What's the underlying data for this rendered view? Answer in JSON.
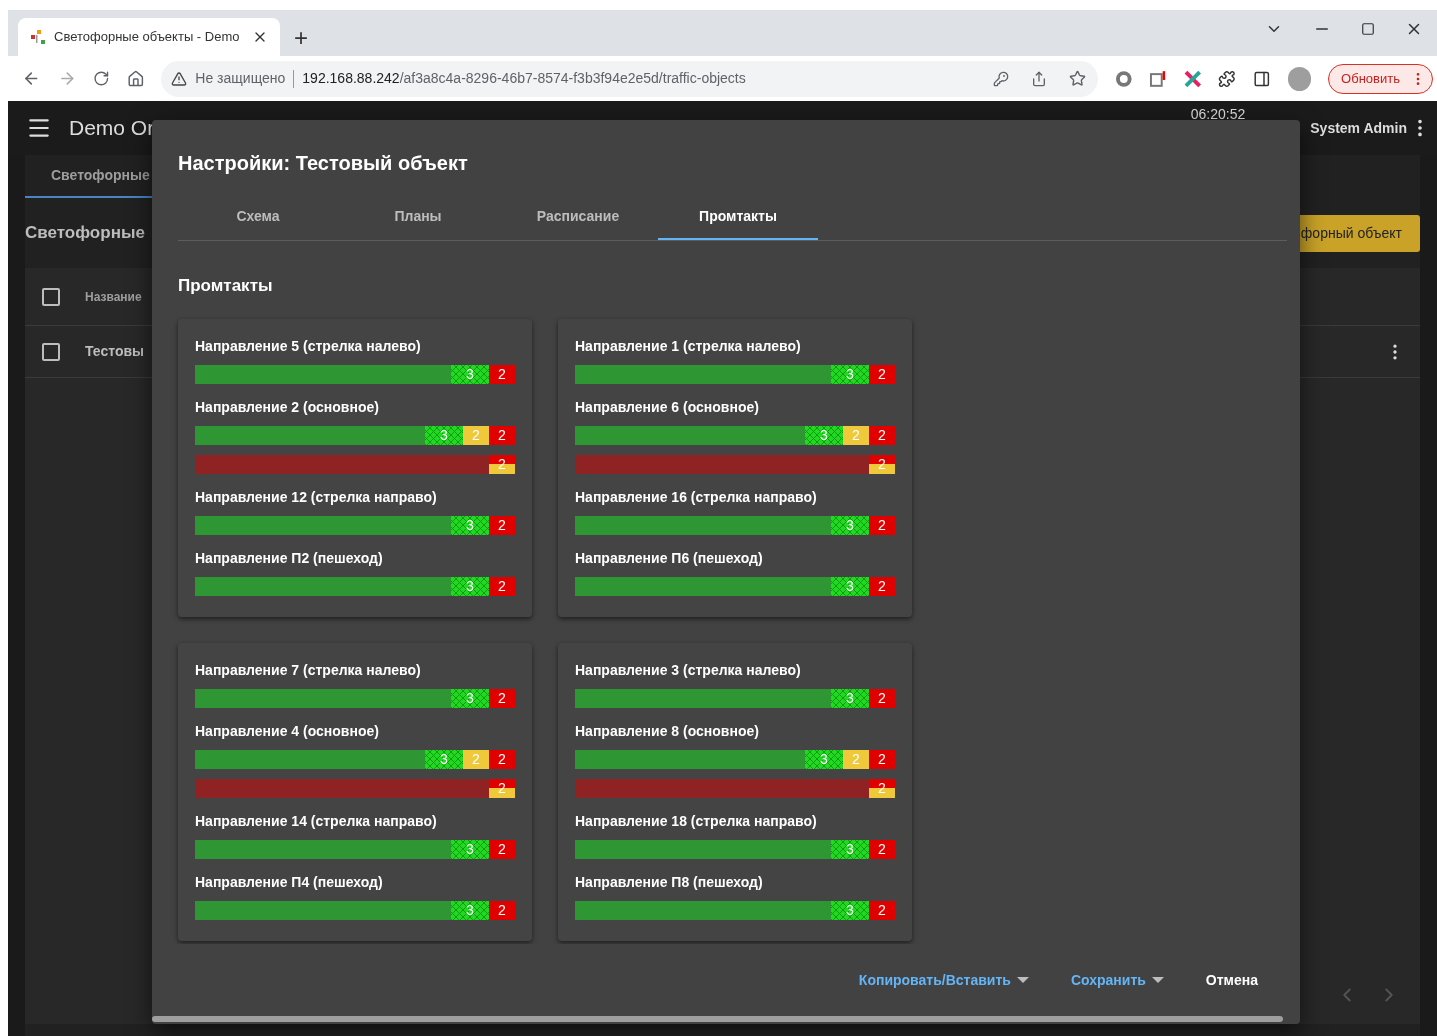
{
  "browser": {
    "tab_title": "Светофорные объекты - Demo ",
    "new_tab": "+",
    "security": "Не защищено",
    "url_host": "192.168.88.242",
    "url_path": "/af3a8c4a-8296-46b7-8574-f3b3f94e2e5d/traffic-objects",
    "update_button": "Обновить"
  },
  "app": {
    "title": "Demo Or",
    "time": "06:20:52",
    "user": "System Admin",
    "nav_tab": "Светофорные",
    "heading": "Светофорные",
    "add_button": "форный объект",
    "table": {
      "header": {
        "checked": false,
        "column_1": "Название"
      },
      "rows": [
        {
          "checked": false,
          "name": "Тестовы"
        }
      ]
    }
  },
  "dialog": {
    "title": "Настройки: Тестовый объект",
    "tabs": [
      {
        "label": "Схема",
        "selected": false
      },
      {
        "label": "Планы",
        "selected": false
      },
      {
        "label": "Расписание",
        "selected": false
      },
      {
        "label": "Промтакты",
        "selected": true
      }
    ],
    "section_title": "Промтакты",
    "cards": [
      {
        "directions": [
          {
            "name": "Направление 5 (стрелка налево)",
            "bars": [
              {
                "kind": "green",
                "segments": [
                  {
                    "kind": "green-flash",
                    "label": "3"
                  },
                  {
                    "kind": "red",
                    "label": "2"
                  }
                ]
              }
            ]
          },
          {
            "name": "Направление 2 (основное)",
            "bars": [
              {
                "kind": "green",
                "segments": [
                  {
                    "kind": "green-flash",
                    "label": "3"
                  },
                  {
                    "kind": "yellow",
                    "label": "2"
                  },
                  {
                    "kind": "red",
                    "label": "2"
                  }
                ]
              },
              {
                "kind": "red",
                "segments": [
                  {
                    "kind": "red-yellow",
                    "label": "2"
                  }
                ]
              }
            ]
          },
          {
            "name": "Направление 12 (стрелка направо)",
            "bars": [
              {
                "kind": "green",
                "segments": [
                  {
                    "kind": "green-flash",
                    "label": "3"
                  },
                  {
                    "kind": "red",
                    "label": "2"
                  }
                ]
              }
            ]
          },
          {
            "name": "Направление П2 (пешеход)",
            "bars": [
              {
                "kind": "green",
                "segments": [
                  {
                    "kind": "green-flash",
                    "label": "3"
                  },
                  {
                    "kind": "red",
                    "label": "2"
                  }
                ]
              }
            ]
          }
        ]
      },
      {
        "directions": [
          {
            "name": "Направление 1 (стрелка налево)",
            "bars": [
              {
                "kind": "green",
                "segments": [
                  {
                    "kind": "green-flash",
                    "label": "3"
                  },
                  {
                    "kind": "red",
                    "label": "2"
                  }
                ]
              }
            ]
          },
          {
            "name": "Направление 6 (основное)",
            "bars": [
              {
                "kind": "green",
                "segments": [
                  {
                    "kind": "green-flash",
                    "label": "3"
                  },
                  {
                    "kind": "yellow",
                    "label": "2"
                  },
                  {
                    "kind": "red",
                    "label": "2"
                  }
                ]
              },
              {
                "kind": "red",
                "segments": [
                  {
                    "kind": "red-yellow",
                    "label": "2"
                  }
                ]
              }
            ]
          },
          {
            "name": "Направление 16 (стрелка направо)",
            "bars": [
              {
                "kind": "green",
                "segments": [
                  {
                    "kind": "green-flash",
                    "label": "3"
                  },
                  {
                    "kind": "red",
                    "label": "2"
                  }
                ]
              }
            ]
          },
          {
            "name": "Направление П6 (пешеход)",
            "bars": [
              {
                "kind": "green",
                "segments": [
                  {
                    "kind": "green-flash",
                    "label": "3"
                  },
                  {
                    "kind": "red",
                    "label": "2"
                  }
                ]
              }
            ]
          }
        ]
      },
      {
        "directions": [
          {
            "name": "Направление 7 (стрелка налево)",
            "bars": [
              {
                "kind": "green",
                "segments": [
                  {
                    "kind": "green-flash",
                    "label": "3"
                  },
                  {
                    "kind": "red",
                    "label": "2"
                  }
                ]
              }
            ]
          },
          {
            "name": "Направление 4 (основное)",
            "bars": [
              {
                "kind": "green",
                "segments": [
                  {
                    "kind": "green-flash",
                    "label": "3"
                  },
                  {
                    "kind": "yellow",
                    "label": "2"
                  },
                  {
                    "kind": "red",
                    "label": "2"
                  }
                ]
              },
              {
                "kind": "red",
                "segments": [
                  {
                    "kind": "red-yellow",
                    "label": "2"
                  }
                ]
              }
            ]
          },
          {
            "name": "Направление 14 (стрелка направо)",
            "bars": [
              {
                "kind": "green",
                "segments": [
                  {
                    "kind": "green-flash",
                    "label": "3"
                  },
                  {
                    "kind": "red",
                    "label": "2"
                  }
                ]
              }
            ]
          },
          {
            "name": "Направление П4 (пешеход)",
            "bars": [
              {
                "kind": "green",
                "segments": [
                  {
                    "kind": "green-flash",
                    "label": "3"
                  },
                  {
                    "kind": "red",
                    "label": "2"
                  }
                ]
              }
            ]
          }
        ]
      },
      {
        "directions": [
          {
            "name": "Направление 3 (стрелка налево)",
            "bars": [
              {
                "kind": "green",
                "segments": [
                  {
                    "kind": "green-flash",
                    "label": "3"
                  },
                  {
                    "kind": "red",
                    "label": "2"
                  }
                ]
              }
            ]
          },
          {
            "name": "Направление 8 (основное)",
            "bars": [
              {
                "kind": "green",
                "segments": [
                  {
                    "kind": "green-flash",
                    "label": "3"
                  },
                  {
                    "kind": "yellow",
                    "label": "2"
                  },
                  {
                    "kind": "red",
                    "label": "2"
                  }
                ]
              },
              {
                "kind": "red",
                "segments": [
                  {
                    "kind": "red-yellow",
                    "label": "2"
                  }
                ]
              }
            ]
          },
          {
            "name": "Направление 18 (стрелка направо)",
            "bars": [
              {
                "kind": "green",
                "segments": [
                  {
                    "kind": "green-flash",
                    "label": "3"
                  },
                  {
                    "kind": "red",
                    "label": "2"
                  }
                ]
              }
            ]
          },
          {
            "name": "Направление П8 (пешеход)",
            "bars": [
              {
                "kind": "green",
                "segments": [
                  {
                    "kind": "green-flash",
                    "label": "3"
                  },
                  {
                    "kind": "red",
                    "label": "2"
                  }
                ]
              }
            ]
          }
        ]
      }
    ],
    "buttons": [
      {
        "label": "Копировать/Вставить",
        "kind": "menu"
      },
      {
        "label": "Сохранить",
        "kind": "menu"
      },
      {
        "label": "Отмена",
        "kind": "plain"
      }
    ]
  }
}
